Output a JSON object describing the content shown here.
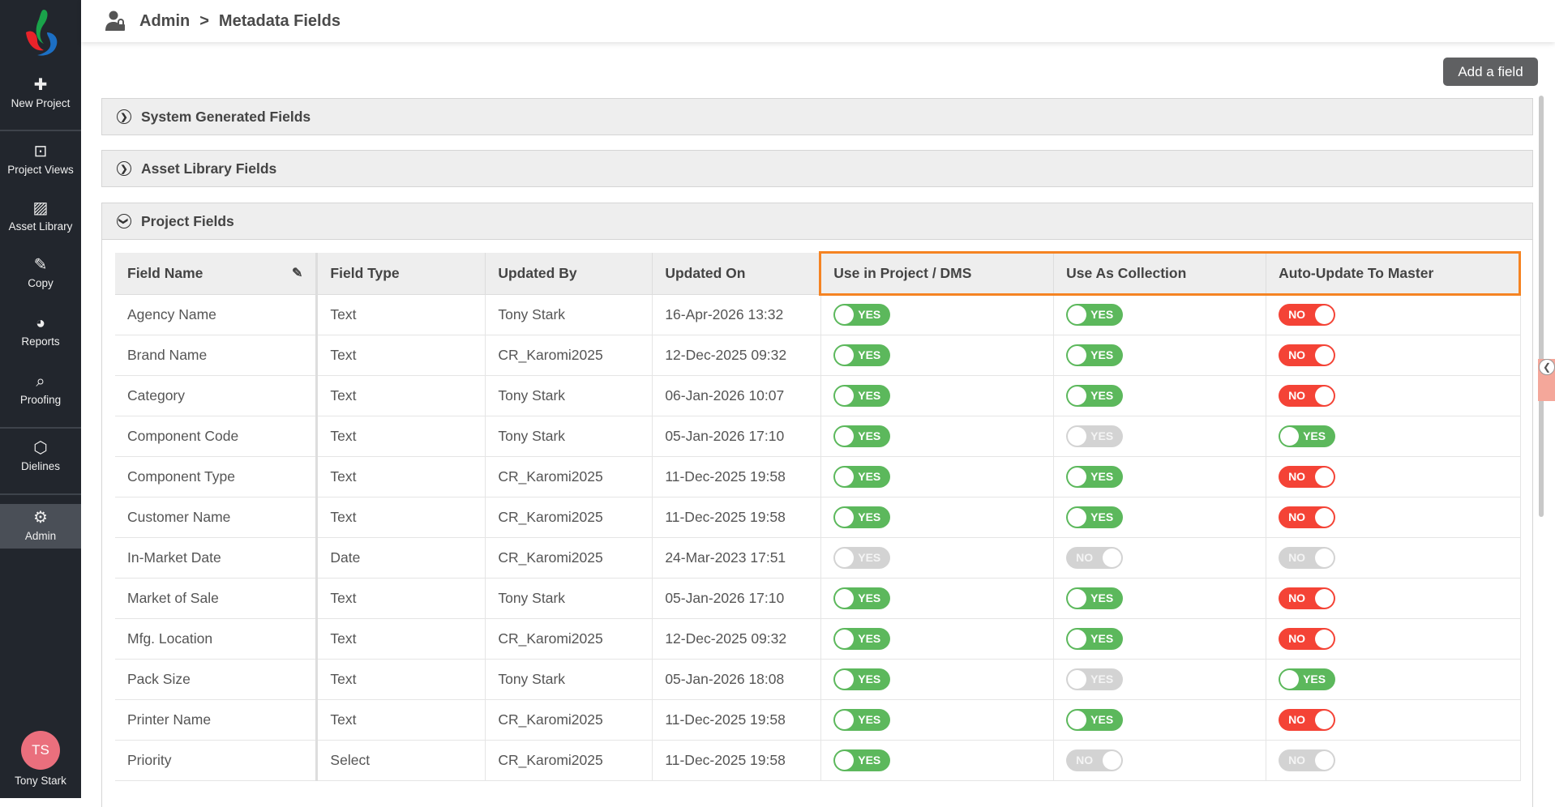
{
  "sidebar": {
    "items": [
      {
        "label": "New Project",
        "icon": "plus-icon",
        "glyph": "✚"
      },
      {
        "label": "Project Views",
        "icon": "archive-icon",
        "glyph": "⊡"
      },
      {
        "label": "Asset Library",
        "icon": "image-icon",
        "glyph": "▨"
      },
      {
        "label": "Copy",
        "icon": "edit-document-icon",
        "glyph": "✎"
      },
      {
        "label": "Reports",
        "icon": "pie-chart-icon",
        "glyph": "◕"
      },
      {
        "label": "Proofing",
        "icon": "proof-search-icon",
        "glyph": "⌕"
      },
      {
        "label": "Dielines",
        "icon": "cube-icon",
        "glyph": "⬡"
      },
      {
        "label": "Admin",
        "icon": "user-shield-icon",
        "glyph": "⚙"
      }
    ],
    "active": "Admin",
    "user": {
      "initials": "TS",
      "name": "Tony Stark"
    }
  },
  "header": {
    "section": "Admin",
    "separator": ">",
    "page": "Metadata Fields"
  },
  "add_field_label": "Add a field",
  "panels": {
    "system": "System Generated Fields",
    "asset": "Asset Library Fields",
    "project": "Project Fields"
  },
  "table": {
    "columns": [
      "Field Name",
      "Field Type",
      "Updated By",
      "Updated On",
      "Use in Project / DMS",
      "Use As Collection",
      "Auto-Update To Master"
    ],
    "rows": [
      {
        "name": "Agency Name",
        "type": "Text",
        "by": "Tony Stark",
        "on": "16-Apr-2026 13:32",
        "t": [
          [
            "YES",
            "on",
            0
          ],
          [
            "YES",
            "on",
            0
          ],
          [
            "NO",
            "off",
            0
          ]
        ]
      },
      {
        "name": "Brand Name",
        "type": "Text",
        "by": "CR_Karomi2025",
        "on": "12-Dec-2025 09:32",
        "t": [
          [
            "YES",
            "on",
            0
          ],
          [
            "YES",
            "on",
            0
          ],
          [
            "NO",
            "off",
            0
          ]
        ]
      },
      {
        "name": "Category",
        "type": "Text",
        "by": "Tony Stark",
        "on": "06-Jan-2026 10:07",
        "t": [
          [
            "YES",
            "on",
            0
          ],
          [
            "YES",
            "on",
            0
          ],
          [
            "NO",
            "off",
            0
          ]
        ]
      },
      {
        "name": "Component Code",
        "type": "Text",
        "by": "Tony Stark",
        "on": "05-Jan-2026 17:10",
        "t": [
          [
            "YES",
            "on",
            0
          ],
          [
            "YES",
            "on",
            1
          ],
          [
            "YES",
            "on",
            0
          ]
        ]
      },
      {
        "name": "Component Type",
        "type": "Text",
        "by": "CR_Karomi2025",
        "on": "11-Dec-2025 19:58",
        "t": [
          [
            "YES",
            "on",
            0
          ],
          [
            "YES",
            "on",
            0
          ],
          [
            "NO",
            "off",
            0
          ]
        ]
      },
      {
        "name": "Customer Name",
        "type": "Text",
        "by": "CR_Karomi2025",
        "on": "11-Dec-2025 19:58",
        "t": [
          [
            "YES",
            "on",
            0
          ],
          [
            "YES",
            "on",
            0
          ],
          [
            "NO",
            "off",
            0
          ]
        ]
      },
      {
        "name": "In-Market Date",
        "type": "Date",
        "by": "CR_Karomi2025",
        "on": "24-Mar-2023 17:51",
        "t": [
          [
            "YES",
            "on",
            1
          ],
          [
            "NO",
            "off",
            1
          ],
          [
            "NO",
            "off",
            1
          ]
        ]
      },
      {
        "name": "Market of Sale",
        "type": "Text",
        "by": "Tony Stark",
        "on": "05-Jan-2026 17:10",
        "t": [
          [
            "YES",
            "on",
            0
          ],
          [
            "YES",
            "on",
            0
          ],
          [
            "NO",
            "off",
            0
          ]
        ]
      },
      {
        "name": "Mfg. Location",
        "type": "Text",
        "by": "CR_Karomi2025",
        "on": "12-Dec-2025 09:32",
        "t": [
          [
            "YES",
            "on",
            0
          ],
          [
            "YES",
            "on",
            0
          ],
          [
            "NO",
            "off",
            0
          ]
        ]
      },
      {
        "name": "Pack Size",
        "type": "Text",
        "by": "Tony Stark",
        "on": "05-Jan-2026 18:08",
        "t": [
          [
            "YES",
            "on",
            0
          ],
          [
            "YES",
            "on",
            1
          ],
          [
            "YES",
            "on",
            0
          ]
        ]
      },
      {
        "name": "Printer Name",
        "type": "Text",
        "by": "CR_Karomi2025",
        "on": "11-Dec-2025 19:58",
        "t": [
          [
            "YES",
            "on",
            0
          ],
          [
            "YES",
            "on",
            0
          ],
          [
            "NO",
            "off",
            0
          ]
        ]
      },
      {
        "name": "Priority",
        "type": "Select",
        "by": "CR_Karomi2025",
        "on": "11-Dec-2025 19:58",
        "t": [
          [
            "YES",
            "on",
            0
          ],
          [
            "NO",
            "off",
            1
          ],
          [
            "NO",
            "off",
            1
          ]
        ]
      }
    ]
  },
  "colors": {
    "sidebar": "#22262d",
    "highlight": "#f58322",
    "yes": "#5cb85c",
    "no": "#f44336",
    "disabled": "#d3d3d3"
  }
}
